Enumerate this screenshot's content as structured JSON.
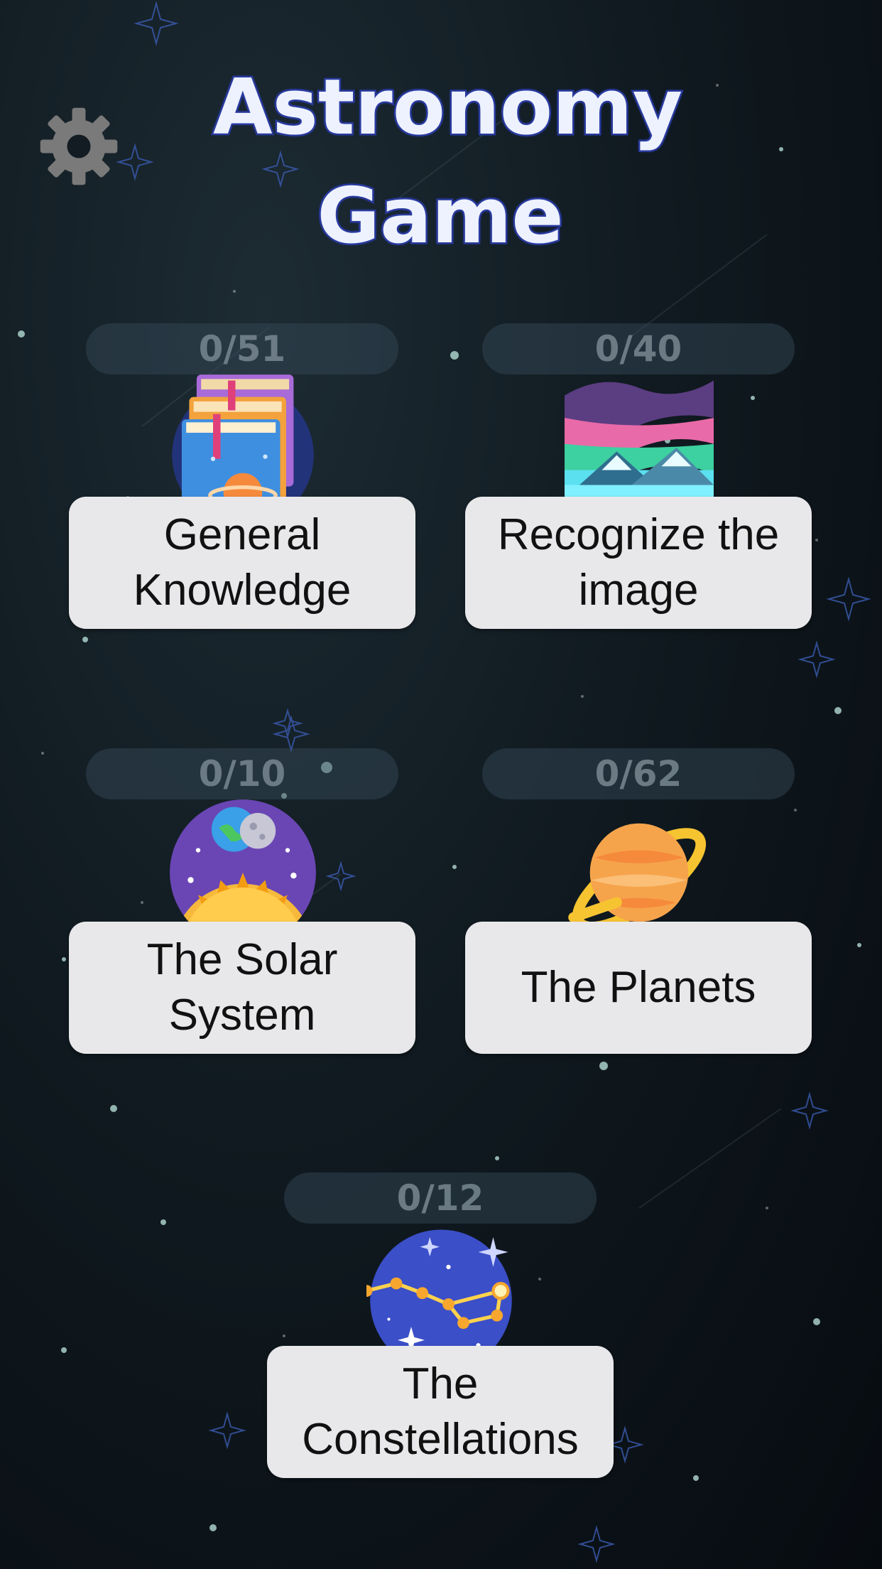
{
  "app": {
    "title": "Astronomy Game"
  },
  "header": {
    "title_line1": "Astronomy",
    "title_line2": "Game",
    "settings_icon": "gear-icon"
  },
  "categories": [
    {
      "label": "General Knowledge",
      "progress": "0/51",
      "icon": "books-planet-icon"
    },
    {
      "label": "Recognize the image",
      "progress": "0/40",
      "icon": "aurora-landscape-icon"
    },
    {
      "label": "The Solar System",
      "progress": "0/10",
      "icon": "solar-system-icon"
    },
    {
      "label": "The Planets",
      "progress": "0/62",
      "icon": "ringed-planet-icon"
    },
    {
      "label": "The Constellations",
      "progress": "0/12",
      "icon": "constellation-icon"
    }
  ],
  "colors": {
    "title_fill": "#eef2ff",
    "title_outline": "#2a3a9a",
    "button_bg": "#e8e8ea",
    "badge_text": "#78878f"
  }
}
